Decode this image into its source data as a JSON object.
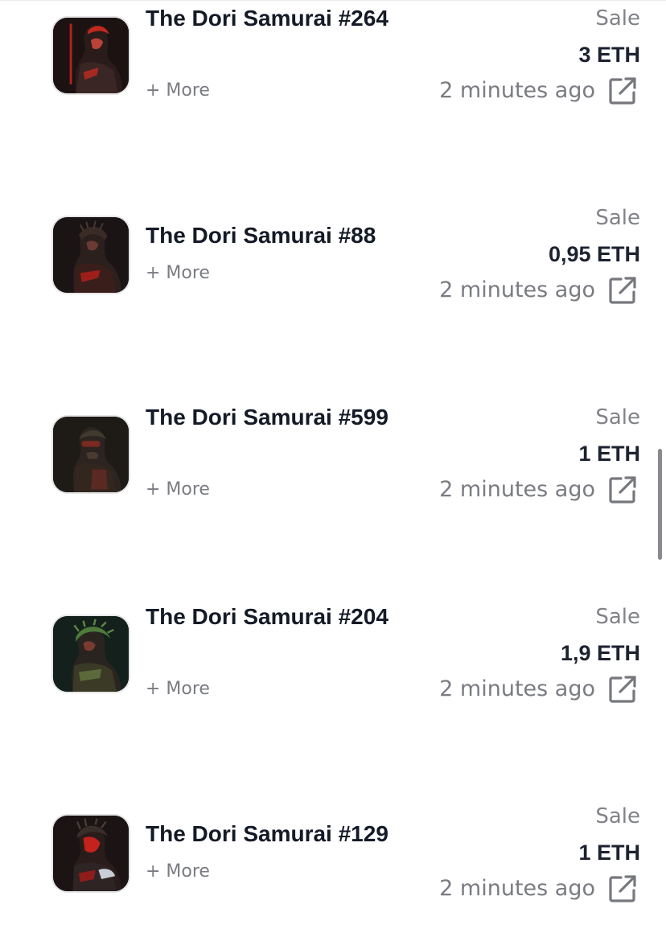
{
  "activity": [
    {
      "name": "The Dori Samurai #264",
      "more_label": "+ More",
      "event": "Sale",
      "price": "3 ETH",
      "time": "2 minutes ago",
      "icon": "external-link-icon",
      "accent": "#c0281e"
    },
    {
      "name": "The Dori Samurai #88",
      "more_label": "+ More",
      "event": "Sale",
      "price": "0,95 ETH",
      "time": "2 minutes ago",
      "icon": "external-link-icon",
      "accent": "#9e1f1a"
    },
    {
      "name": "The Dori Samurai #599",
      "more_label": "+ More",
      "event": "Sale",
      "price": "1 ETH",
      "time": "2 minutes ago",
      "icon": "external-link-icon",
      "accent": "#7a2a20"
    },
    {
      "name": "The Dori Samurai #204",
      "more_label": "+ More",
      "event": "Sale",
      "price": "1,9 ETH",
      "time": "2 minutes ago",
      "icon": "external-link-icon",
      "accent": "#4e7a3a"
    },
    {
      "name": "The Dori Samurai #129",
      "more_label": "+ More",
      "event": "Sale",
      "price": "1 ETH",
      "time": "2 minutes ago",
      "icon": "external-link-icon",
      "accent": "#c4221c"
    }
  ]
}
